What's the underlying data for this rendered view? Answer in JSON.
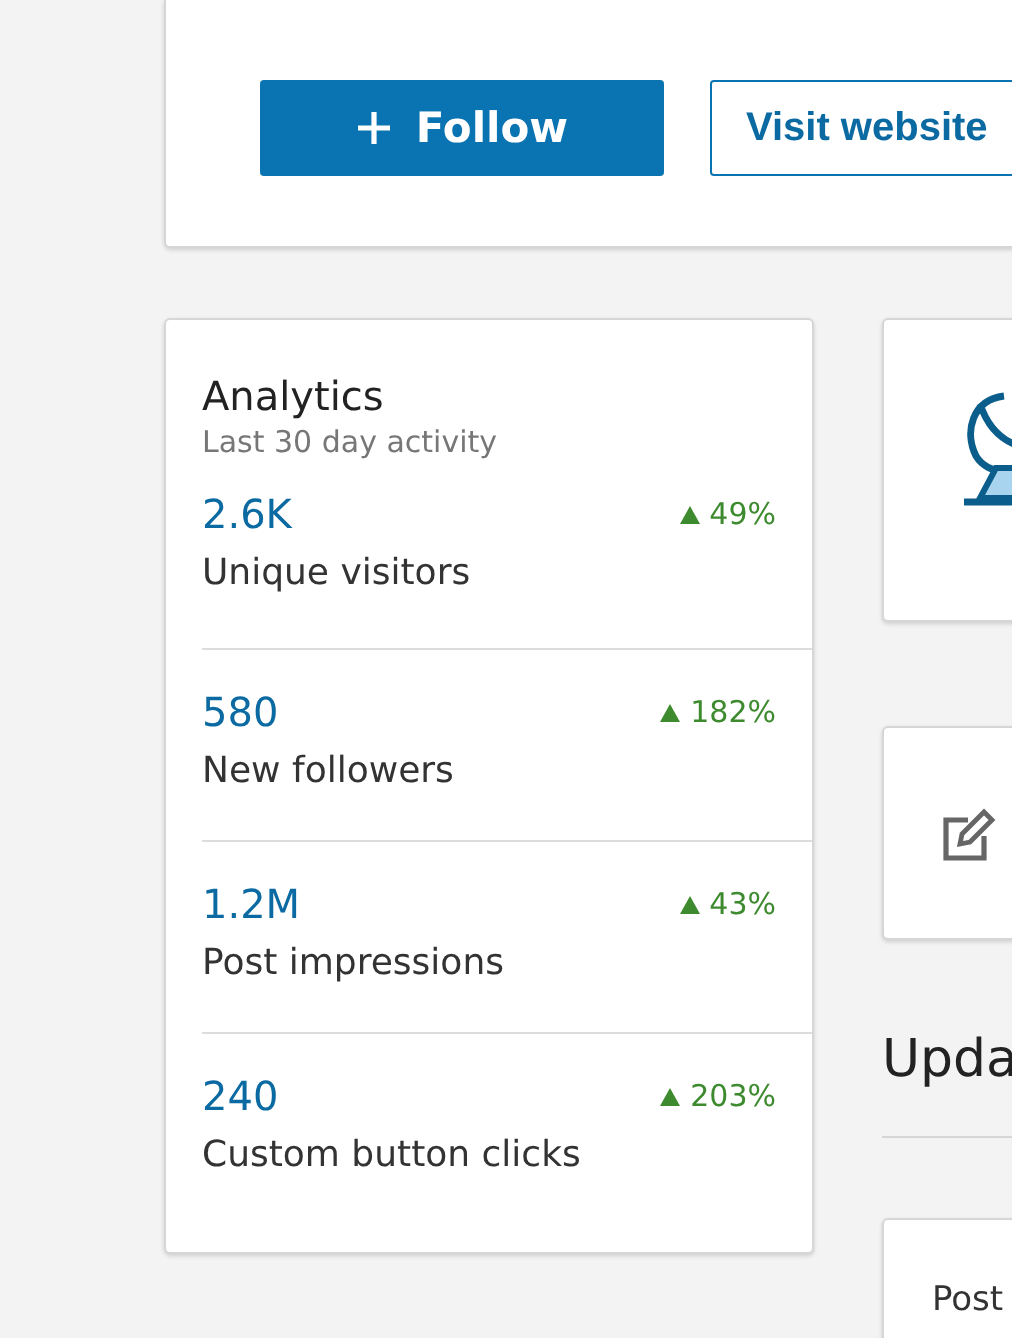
{
  "header_actions": {
    "follow": "Follow",
    "visit": "Visit website"
  },
  "analytics": {
    "title": "Analytics",
    "subtitle": "Last 30 day activity",
    "metrics": [
      {
        "value": "2.6K",
        "label": "Unique visitors",
        "change": "49%",
        "kind": "rise"
      },
      {
        "value": "580",
        "label": "New followers",
        "change": "182%",
        "kind": "rise"
      },
      {
        "value": "1.2M",
        "label": "Post impressions",
        "change": "43%",
        "kind": "rise"
      },
      {
        "value": "240",
        "label": "Custom button clicks",
        "change": "203%",
        "kind": "rise"
      }
    ]
  },
  "updates": {
    "heading": "Upda",
    "post_label": "Post"
  }
}
